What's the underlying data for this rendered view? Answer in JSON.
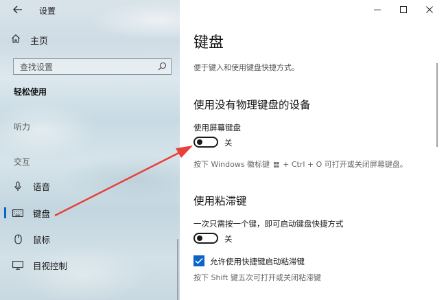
{
  "window": {
    "title": "设置"
  },
  "sidebar": {
    "home_label": "主页",
    "search_placeholder": "查找设置",
    "section_title": "轻松使用",
    "group_hearing": "听力",
    "group_interaction": "交互",
    "items": [
      {
        "label": "语音",
        "icon": "microphone-icon"
      },
      {
        "label": "键盘",
        "icon": "keyboard-icon",
        "active": true
      },
      {
        "label": "鼠标",
        "icon": "mouse-icon"
      },
      {
        "label": "目视控制",
        "icon": "eye-control-icon"
      }
    ]
  },
  "content": {
    "title": "键盘",
    "subtitle": "便于键入和使用键盘快捷方式。",
    "section1": {
      "heading": "使用没有物理键盘的设备",
      "toggle_label": "使用屏幕键盘",
      "toggle_state": "关",
      "hint_prefix": "按下 Windows 徽标键",
      "hint_suffix": "+ Ctrl + O 可打开或关闭屏幕键盘。"
    },
    "section2": {
      "heading": "使用粘滞键",
      "toggle_label": "一次只需按一个键，即可启动键盘快捷方式",
      "toggle_state": "关",
      "checkbox_label": "允许使用快捷键启动粘滞键",
      "hint": "按下 Shift 键五次可打开或关闭粘滞键"
    }
  },
  "colors": {
    "accent": "#0a63c9",
    "arrow": "#e8403a"
  }
}
